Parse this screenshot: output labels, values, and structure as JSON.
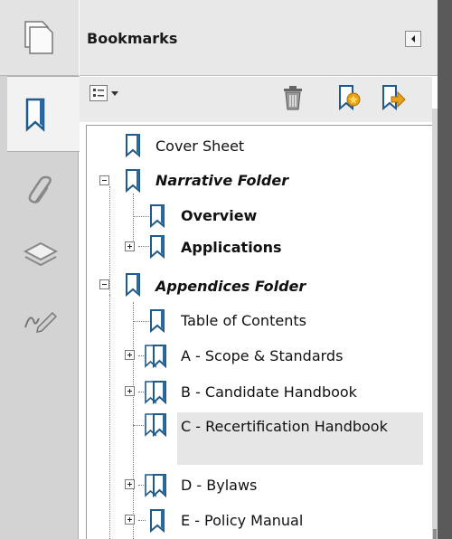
{
  "panel": {
    "title": "Bookmarks"
  },
  "rail": {
    "icons": [
      "pages-icon",
      "bookmarks-icon",
      "attachments-icon",
      "layers-icon",
      "signatures-icon"
    ]
  },
  "toolbar": {
    "options_icon": "options-icon",
    "delete_icon": "delete-bookmark-icon",
    "new_icon": "new-bookmark-icon",
    "expand_icon": "expand-bookmark-icon"
  },
  "bookmarks": {
    "cover_sheet": "Cover Sheet",
    "narrative_folder": "Narrative Folder",
    "overview": "Overview",
    "applications": "Applications",
    "appendices_folder": "Appendices Folder",
    "table_of_contents": "Table of Contents",
    "scope_standards": "A - Scope & Standards",
    "candidate_handbook": "B - Candidate Handbook",
    "recertification_handbook": "C - Recertification Handbook",
    "bylaws": "D - Bylaws",
    "policy_manual": "E - Policy Manual"
  },
  "colors": {
    "bookmark_fill": "#ffffff",
    "bookmark_stroke": "#1f5a8a",
    "bookmark_dark": "#2a6aa0",
    "rail_bg": "#d3d3d3",
    "selected_row": "#e6e6e6"
  }
}
